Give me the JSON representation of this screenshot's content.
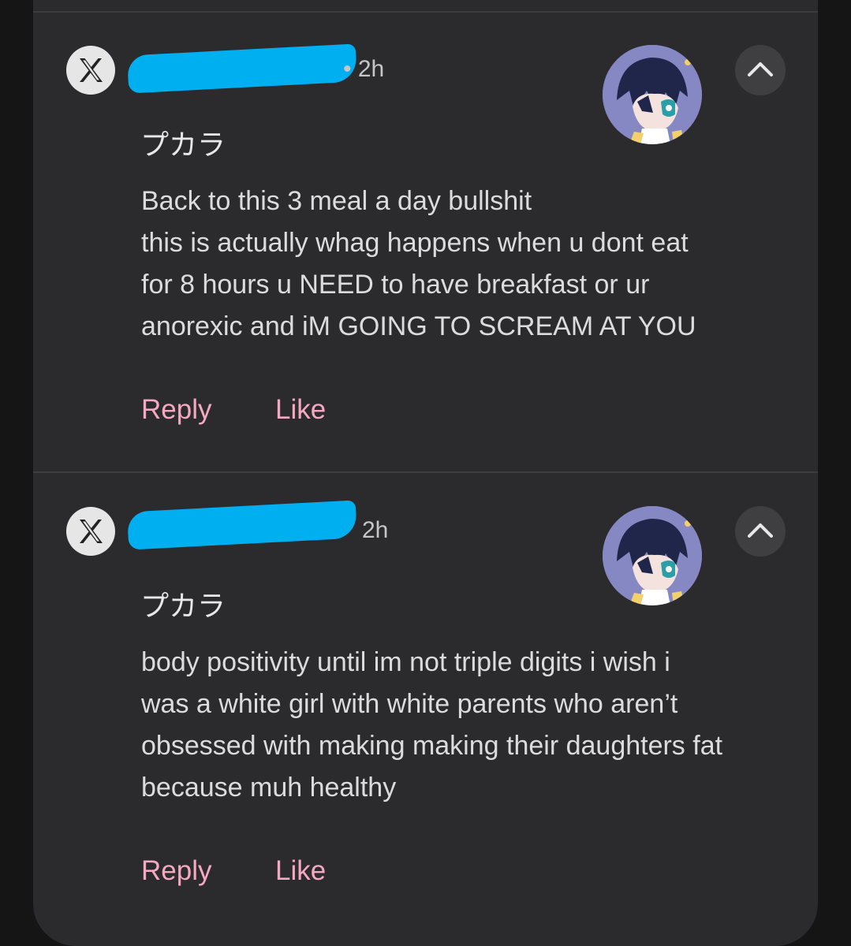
{
  "comments": [
    {
      "source_icon": "x-logo-icon",
      "timestamp": "• 2h",
      "channel_name": "プカラ",
      "body_lines": [
        "Back to this 3 meal a day bullshit",
        "this is actually whag happens when u dont eat",
        "for 8 hours u NEED to have breakfast or ur",
        "anorexic and iM GOING TO SCREAM AT YOU"
      ],
      "reply_label": "Reply",
      "like_label": "Like",
      "collapse_icon": "chevron-up-icon"
    },
    {
      "source_icon": "x-logo-icon",
      "timestamp": "2h",
      "channel_name": "プカラ",
      "body_lines": [
        "body positivity until im not triple digits i wish i",
        "was a white girl with white parents who aren’t",
        "obsessed with making making their daughters fat",
        "because muh healthy"
      ],
      "reply_label": "Reply",
      "like_label": "Like",
      "collapse_icon": "chevron-up-icon"
    }
  ],
  "colors": {
    "background": "#151515",
    "panel": "#2b2b2d",
    "action_text": "#f4a9c0",
    "redaction": "#00aff0"
  }
}
